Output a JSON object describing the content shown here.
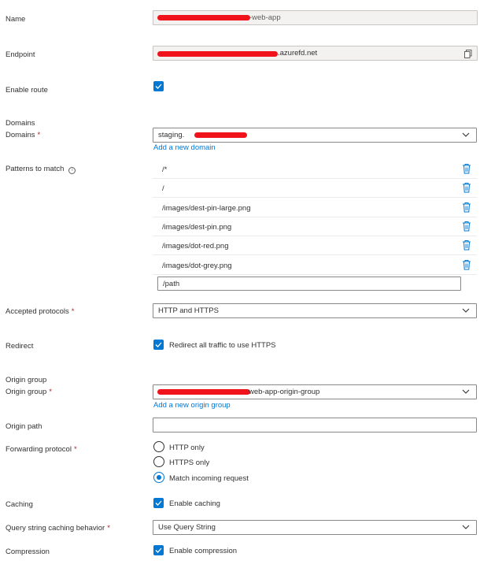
{
  "name": {
    "label": "Name",
    "value": "-web-app"
  },
  "endpoint": {
    "label": "Endpoint",
    "value": ".azurefd.net"
  },
  "enable_route": {
    "label": "Enable route",
    "checked": true
  },
  "domains_section": {
    "title": "Domains",
    "label": "Domains",
    "value": "staging.",
    "add_link": "Add a new domain"
  },
  "patterns": {
    "label": "Patterns to match",
    "items": [
      "/*",
      "/",
      "/images/dest-pin-large.png",
      "/images/dest-pin.png",
      "/images/dot-red.png",
      "/images/dot-grey.png"
    ],
    "new_placeholder": "/path"
  },
  "accepted_protocols": {
    "label": "Accepted protocols",
    "value": "HTTP and HTTPS"
  },
  "redirect": {
    "label": "Redirect",
    "checkbox_label": "Redirect all traffic to use HTTPS",
    "checked": true
  },
  "origin_group_section": {
    "title": "Origin group",
    "label": "Origin group",
    "value": "web-app-origin-group",
    "add_link": "Add a new origin group"
  },
  "origin_path": {
    "label": "Origin path",
    "value": ""
  },
  "forwarding_protocol": {
    "label": "Forwarding protocol",
    "options": [
      "HTTP only",
      "HTTPS only",
      "Match incoming request"
    ],
    "selected": "Match incoming request"
  },
  "caching": {
    "label": "Caching",
    "checkbox_label": "Enable caching",
    "checked": true
  },
  "query_string": {
    "label": "Query string caching behavior",
    "value": "Use Query String"
  },
  "compression": {
    "label": "Compression",
    "checkbox_label": "Enable compression",
    "checked": true
  },
  "required_marker": "*",
  "colors": {
    "accent": "#0078d4",
    "required": "#a4262c",
    "redaction": "#f0131b",
    "text": "#323130"
  },
  "icons": {
    "chevron": "chevron-down-icon",
    "trash": "trash-icon",
    "copy": "copy-icon",
    "info": "info-icon",
    "check": "checkmark-icon"
  }
}
